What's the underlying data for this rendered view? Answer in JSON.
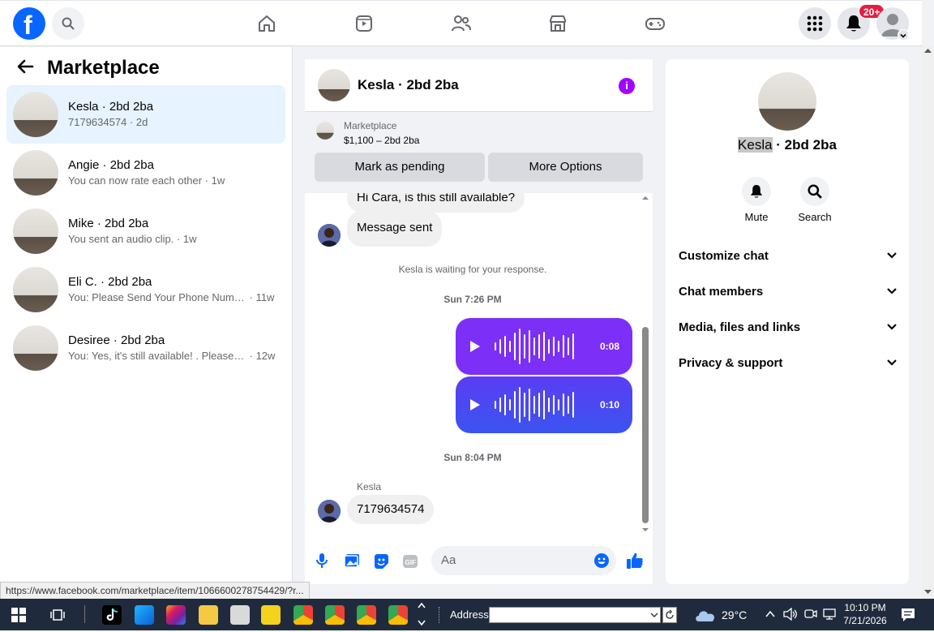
{
  "topbar": {
    "logo_icon": "facebook-logo-icon",
    "search_icon": "search-icon",
    "nav_icons": [
      "home-icon",
      "video-icon",
      "friends-icon",
      "marketplace-icon",
      "gaming-icon"
    ],
    "notification_badge": "20+"
  },
  "left": {
    "title": "Marketplace",
    "conversations": [
      {
        "name": "Kesla · 2bd 2ba",
        "preview": "7179634574",
        "time": "2d",
        "selected": true
      },
      {
        "name": "Angie · 2bd 2ba",
        "preview": "You can now rate each other",
        "time": "1w",
        "selected": false
      },
      {
        "name": "Mike · 2bd 2ba",
        "preview": "You sent an audio clip.",
        "time": "1w",
        "selected": false
      },
      {
        "name": "Eli C. · 2bd 2ba",
        "preview": "You: Please Send Your Phone Numb...",
        "time": "11w",
        "selected": false
      },
      {
        "name": "Desiree · 2bd 2ba",
        "preview": "You: Yes, it's still available! . Please te...",
        "time": "12w",
        "selected": false
      }
    ]
  },
  "chat": {
    "title": "Kesla · 2bd 2ba",
    "listing": {
      "source": "Marketplace",
      "price": "$1,100 – 2bd 2ba",
      "pending_button": "Mark as pending",
      "options_button": "More Options"
    },
    "messages": {
      "m1": "Hi Cara, is this still available?",
      "m2": "Message sent",
      "waiting": "Kesla is waiting for your response.",
      "stamp1": "Sun 7:26 PM",
      "audio1": "0:08",
      "audio2": "0:10",
      "stamp2": "Sun 8:04 PM",
      "sender": "Kesla",
      "m3": "7179634574"
    },
    "composer_placeholder": "Aa",
    "colors": {
      "audio_top": "#7b2ff7",
      "audio_bottom": "#4b4af0",
      "accent": "#0866ff"
    }
  },
  "right": {
    "name_first": "Kesla",
    "name_rest": " · 2bd 2ba",
    "actions": [
      {
        "label": "Mute",
        "icon": "bell-icon"
      },
      {
        "label": "Search",
        "icon": "search-icon"
      }
    ],
    "sections": [
      "Customize chat",
      "Chat members",
      "Media, files and links",
      "Privacy & support"
    ]
  },
  "status_url": "https://www.facebook.com/marketplace/item/1066600278754429/?r...",
  "taskbar": {
    "address_label": "Address",
    "temperature": "29°C",
    "time": "10:10 PM",
    "date": "7/21/2026"
  }
}
